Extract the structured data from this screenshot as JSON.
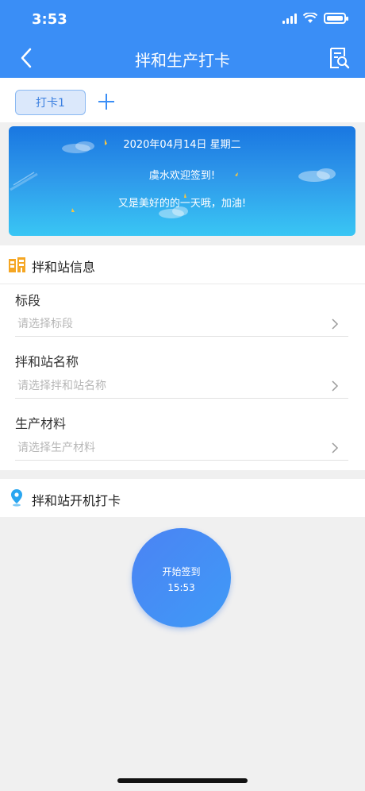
{
  "status_bar": {
    "time": "3:53"
  },
  "nav": {
    "title": "拌和生产打卡"
  },
  "tabs": [
    {
      "label": "打卡1"
    }
  ],
  "banner": {
    "date_text": "2020年04月14日 星期二",
    "welcome_text": "虞水欢迎签到!",
    "motto_text": "又是美好的的一天哦，加油!"
  },
  "station_info": {
    "title": "拌和站信息",
    "fields": [
      {
        "label": "标段",
        "placeholder": "请选择标段"
      },
      {
        "label": "拌和站名称",
        "placeholder": "请选择拌和站名称"
      },
      {
        "label": "生产材料",
        "placeholder": "请选择生产材料"
      }
    ]
  },
  "clock_in": {
    "title": "拌和站开机打卡",
    "button_label": "开始签到",
    "button_time": "15:53"
  },
  "colors": {
    "primary": "#3a8ef6",
    "icon_orange": "#f5a623",
    "icon_blue": "#2aa6f0"
  }
}
